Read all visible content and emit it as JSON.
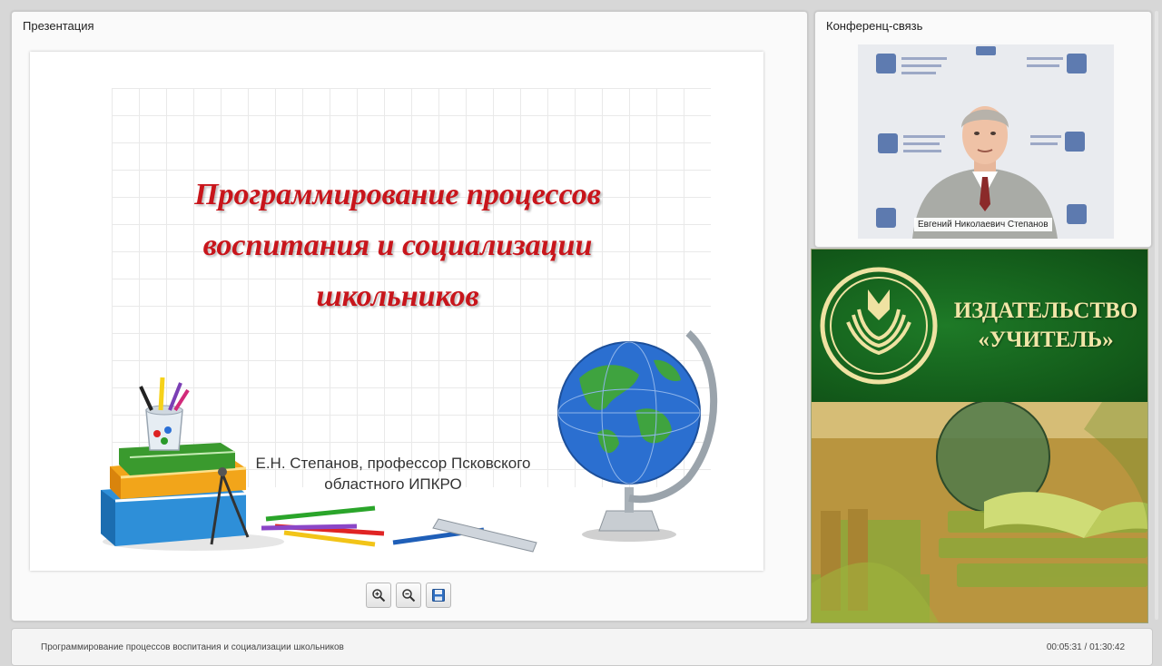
{
  "presentation": {
    "panel_title": "Презентация",
    "slide": {
      "title_line1": "Программирование процессов",
      "title_line2": "воспитания и социализации",
      "title_line3": "школьников",
      "author_line1": "Е.Н. Степанов, профессор Псковского",
      "author_line2": "областного ИПКРО",
      "title_color": "#c8151b"
    },
    "toolbar": {
      "zoom_in_icon": "zoom-in-icon",
      "zoom_out_icon": "zoom-out-icon",
      "save_icon": "floppy-disk-icon"
    }
  },
  "conference": {
    "panel_title": "Конференц-связь",
    "speaker_name": "Евгений Николаевич Степанов"
  },
  "publisher": {
    "name_line1": "ИЗДАТЕЛЬСТВО",
    "name_line2": "«УЧИТЕЛЬ»",
    "brand_green": "#135b1a",
    "brand_gold": "#f1e6a8"
  },
  "bottom_bar": {
    "title": "Программирование процессов воспитания и социализации школьников",
    "time": "00:05:31 / 01:30:42"
  }
}
